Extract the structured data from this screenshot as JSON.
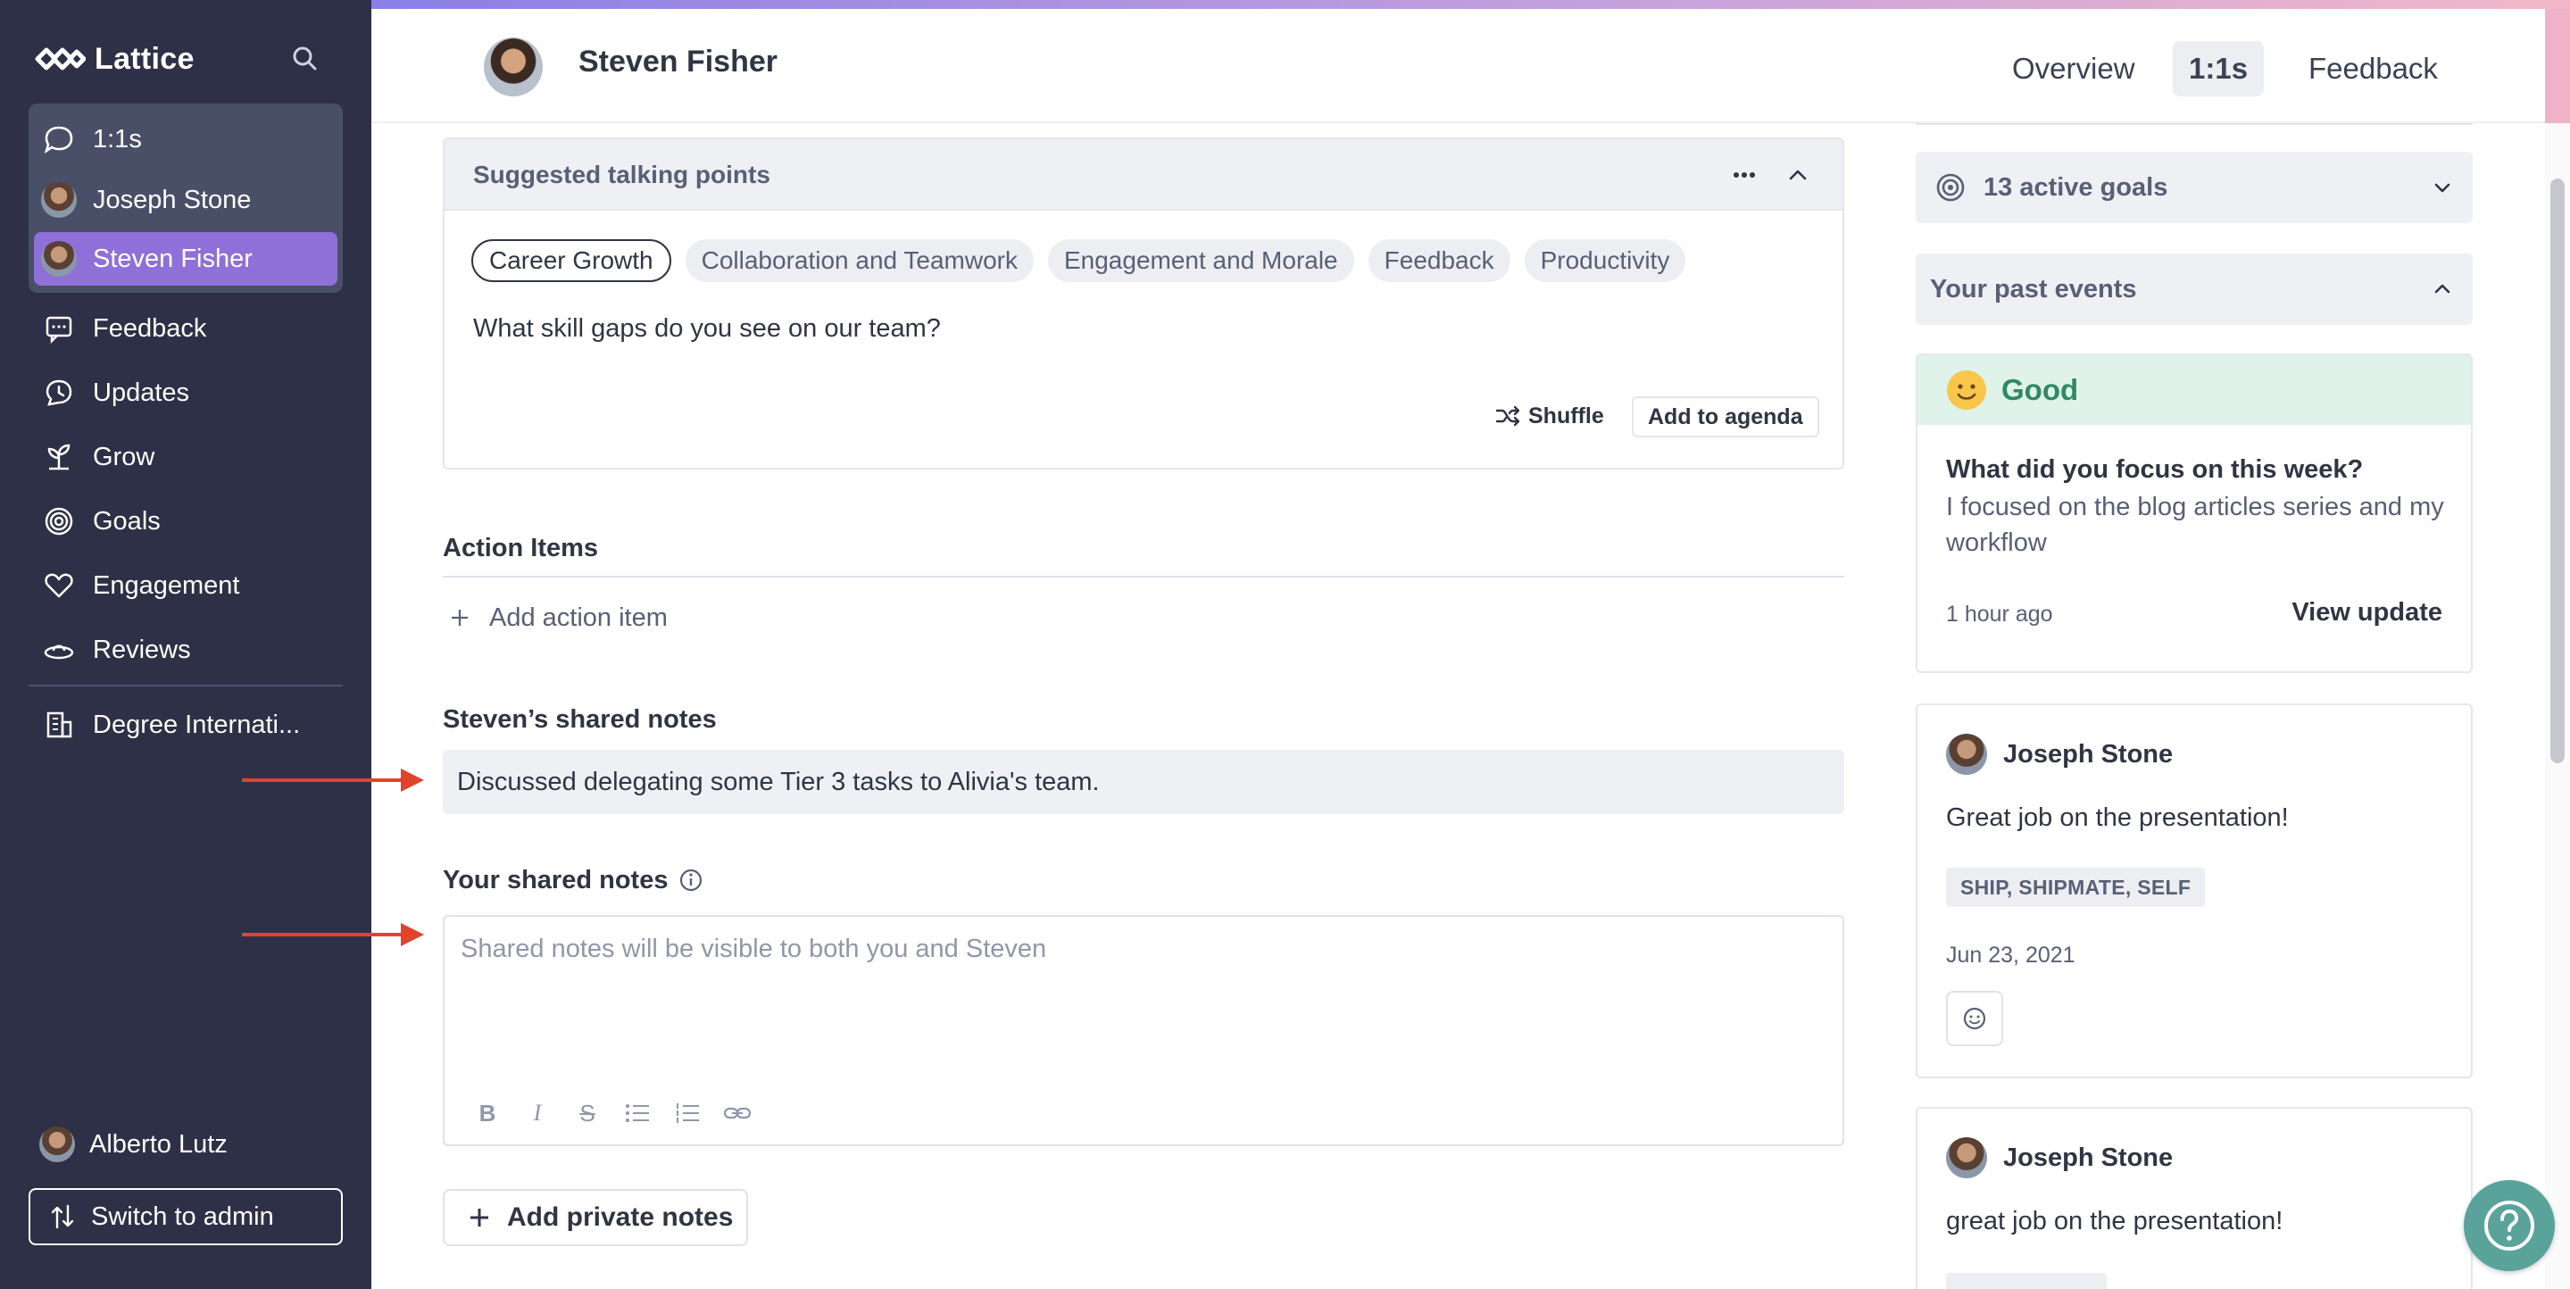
{
  "app": {
    "name": "Lattice"
  },
  "colors": {
    "sidebar_bg": "#2d3047",
    "active_purple": "#8f6fd8",
    "good_green": "#2f8a63",
    "arrow_red": "#e0442b",
    "help_teal": "#5aa39b"
  },
  "sidebar": {
    "oneonone_group": [
      {
        "label": "1:1s",
        "icon": "chat-bubble-icon"
      },
      {
        "label": "Joseph Stone",
        "icon": "avatar"
      },
      {
        "label": "Steven Fisher",
        "icon": "avatar",
        "active": true
      }
    ],
    "nav": [
      {
        "label": "Feedback",
        "icon": "feedback-icon"
      },
      {
        "label": "Updates",
        "icon": "updates-icon"
      },
      {
        "label": "Grow",
        "icon": "grow-icon"
      },
      {
        "label": "Goals",
        "icon": "target-icon"
      },
      {
        "label": "Engagement",
        "icon": "heart-icon"
      },
      {
        "label": "Reviews",
        "icon": "reviews-icon"
      }
    ],
    "org": {
      "label": "Degree Internati...",
      "icon": "building-icon"
    },
    "user": {
      "name": "Alberto Lutz"
    },
    "switch_label": "Switch to admin"
  },
  "header": {
    "person_name": "Steven Fisher",
    "tabs": [
      {
        "label": "Overview"
      },
      {
        "label": "1:1s",
        "active": true
      },
      {
        "label": "Feedback"
      }
    ]
  },
  "talking_points": {
    "title": "Suggested talking points",
    "chips": [
      "Career Growth",
      "Collaboration and Teamwork",
      "Engagement and Morale",
      "Feedback",
      "Productivity"
    ],
    "active_chip": "Career Growth",
    "question": "What skill gaps do you see on our team?",
    "shuffle_label": "Shuffle",
    "add_label": "Add to agenda"
  },
  "action_items": {
    "title": "Action Items",
    "add_label": "Add action item"
  },
  "steven_notes": {
    "title": "Steven’s shared notes",
    "text": "Discussed delegating some Tier 3 tasks to Alivia's team."
  },
  "your_notes": {
    "title": "Your shared notes",
    "placeholder": "Shared notes will be visible to both you and Steven",
    "toolbar": {
      "bold": "B",
      "italic": "I",
      "strike": "S"
    }
  },
  "private_notes": {
    "label": "Add private notes"
  },
  "right": {
    "goals_label": "13 active goals",
    "past_events_title": "Your past events",
    "update_card": {
      "mood": "Good",
      "question": "What did you focus on this week?",
      "answer": "I focused on the blog articles series and my workflow",
      "time": "1 hour ago",
      "link": "View update"
    },
    "feedback_cards": [
      {
        "author": "Joseph Stone",
        "body": "Great job on the presentation!",
        "tag": "SHIP, SHIPMATE, SELF",
        "date": "Jun 23, 2021"
      },
      {
        "author": "Joseph Stone",
        "body": "great job on the presentation!"
      }
    ]
  }
}
